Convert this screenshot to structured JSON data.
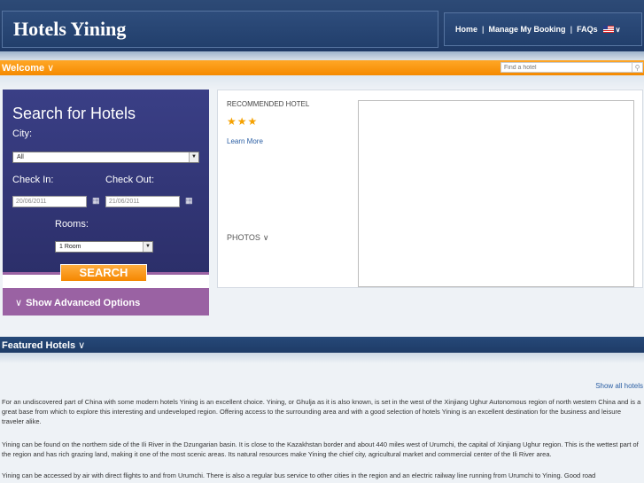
{
  "header": {
    "title": "Hotels Yining",
    "nav": {
      "home": "Home",
      "manage_booking": "Manage My Booking",
      "faqs": "FAQs",
      "separator": "|",
      "flag_chevron": "∨"
    }
  },
  "welcome": {
    "label": "Welcome",
    "chevron": "∨",
    "find_placeholder": "Find a hotel"
  },
  "search": {
    "title": "Search for Hotels",
    "city_label": "City:",
    "city_value": "All",
    "check_in_label": "Check In:",
    "check_out_label": "Check Out:",
    "check_in_value": "20/06/2011",
    "check_out_value": "21/06/2011",
    "rooms_label": "Rooms:",
    "rooms_value": "1 Room",
    "search_button": "SEARCH",
    "advanced_label": "Show Advanced Options",
    "advanced_chevron": "∨"
  },
  "recommended": {
    "title": "RECOMMENDED HOTEL",
    "stars": "★★★",
    "learn_more": "Learn More",
    "photos_label": "PHOTOS",
    "photos_chevron": "∨"
  },
  "featured": {
    "label": "Featured Hotels",
    "chevron": "∨",
    "show_all": "Show all hotels"
  },
  "content": {
    "paragraphs": [
      "For an undiscovered part of China with some modern hotels Yining is an excellent choice. Yining, or Ghulja as it is also known, is set in the west of the Xinjiang Ughur Autonomous region of north western China and is a great base from which to explore this interesting and undeveloped region. Offering access to the surrounding area and with a good selection of hotels Yining is an excellent destination for the business and leisure traveler alike.",
      "Yining can be found on the northern side of the Ili River in the Dzungarian basin. It is close to the Kazakhstan border and about 440 miles west of Urumchi, the capital of Xinjiang Ughur region. This is the wettest part of the region and has rich grazing land, making it one of the most scenic areas. Its natural resources make Yining the chief city, agricultural market and commercial center of the Ili River area.",
      "Yining can be accessed by air with direct flights to and from Urumchi. There is also a regular bus service to other cities in the region and an electric railway line running from Urumchi to Yining. Good road"
    ]
  },
  "colors": {
    "header_bg": "#1f3a66",
    "accent_orange": "#f58a00",
    "search_panel": "#2c2f6a",
    "advanced_bar": "#9a62a3",
    "link": "#2a5ea3"
  }
}
